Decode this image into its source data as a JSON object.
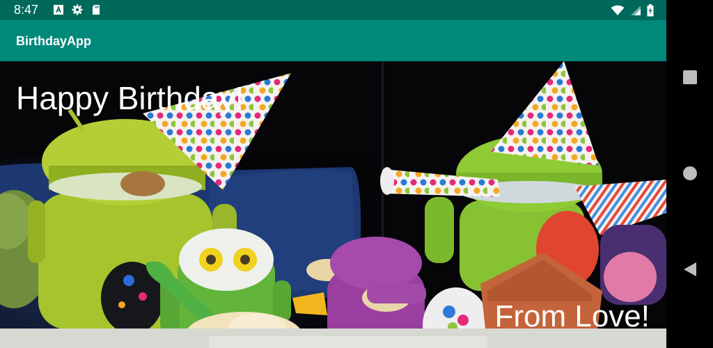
{
  "status_bar": {
    "time": "8:47",
    "icons_left": [
      "font-icon",
      "gear-icon",
      "sd-card-icon"
    ],
    "icons_right": [
      "wifi-icon",
      "signal-icon",
      "battery-charging-icon"
    ],
    "background": "#00695c"
  },
  "app_bar": {
    "title": "BirthdayApp",
    "background": "#00897b"
  },
  "card": {
    "greeting": "Happy Birthday!",
    "signature": "From Love!",
    "image_description_icon": "android-party-photo"
  },
  "nav_bar": {
    "buttons": [
      "recent-apps-icon",
      "home-icon",
      "back-icon"
    ]
  }
}
